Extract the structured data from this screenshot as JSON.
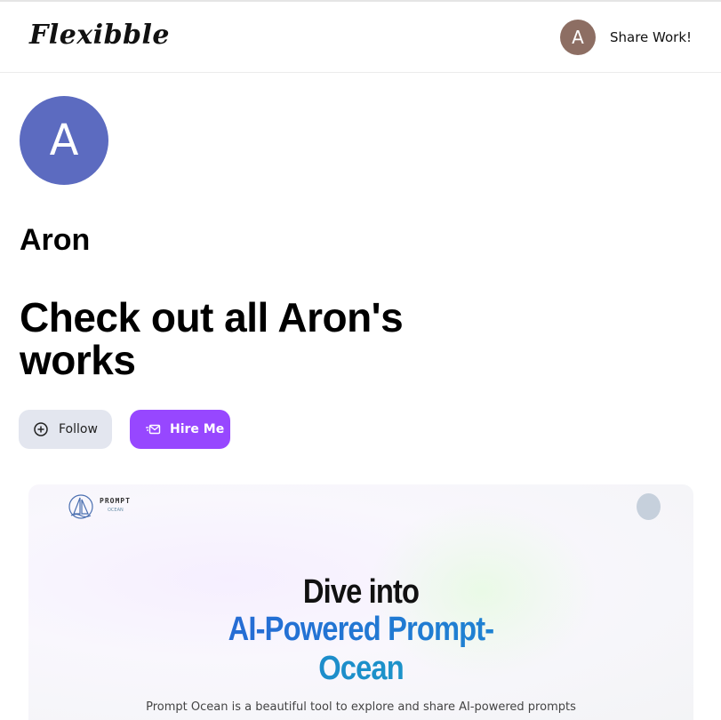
{
  "nav": {
    "logo": "Flexibble",
    "user_initial": "A",
    "share_label": "Share Work!"
  },
  "profile": {
    "initial": "A",
    "name": "Aron",
    "headline": "Check out all Aron's works",
    "follow_label": "Follow",
    "hire_label": "Hire Me"
  },
  "project_preview": {
    "logo_text": "PROMPT",
    "logo_subtext": "OCEAN",
    "hero_line1": "Dive into",
    "hero_line2": "AI-Powered Prompt-",
    "hero_line3": "Ocean",
    "description": "Prompt Ocean is a beautiful tool to explore and share AI-powered prompts"
  },
  "colors": {
    "nav_avatar": "#8d6e63",
    "profile_avatar": "#5c6bc0",
    "follow_button": "#e3e6ef",
    "hire_button": "#9747ff",
    "hero_blue": "#1f6fd8"
  },
  "icons": {
    "follow": "plus-circle-icon",
    "hire": "mail-send-icon"
  }
}
